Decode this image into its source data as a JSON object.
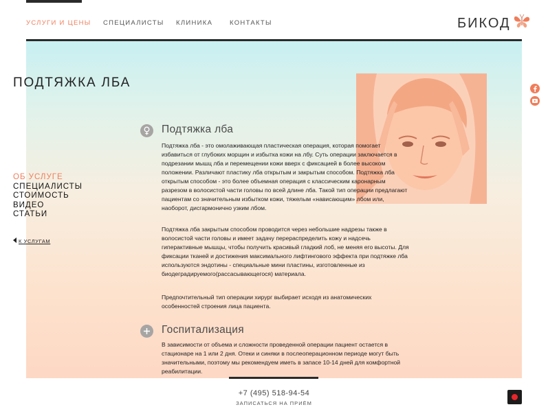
{
  "nav": {
    "items": [
      {
        "label": "УСЛУГИ И ЦЕНЫ"
      },
      {
        "label": "СПЕЦИАЛИСТЫ"
      },
      {
        "label": "КЛИНИКА"
      },
      {
        "label": "КОНТАКТЫ"
      }
    ],
    "active_index": 0,
    "logo_text": "БИКОД"
  },
  "page_title": "ПОДТЯЖКА ЛБА",
  "side_menu": {
    "items": [
      {
        "label": "ОБ УСЛУГЕ"
      },
      {
        "label": "СПЕЦИАЛИСТЫ"
      },
      {
        "label": "СТОИМОСТЬ"
      },
      {
        "label": "ВИДЕО"
      },
      {
        "label": "СТАТЬИ"
      }
    ],
    "active_index": 0,
    "back_label": "К УСЛУГАМ"
  },
  "sections": [
    {
      "icon": "female-symbol-icon",
      "title": "Подтяжка лба",
      "paragraphs": [
        "Подтяжка лба - это омолаживающая пластическая операция, которая помогает избавиться от глубоких морщин и избытка кожи на лбу. Суть операции заключается в подрезании мышц лба и перемещении кожи вверх с фиксацией в более высоком положении. Различают пластику лба открытым и закрытым  способом. Подтяжка лба открытым способом - это более объемная операция с классическим каронарным разрезом в волосистой части головы по всей длине лба. Такой тип операции предлагают пациентам со значительным избытком кожи, тяжелым «нависающим» лбом или, наоборот, дисгармонично узким лбом.",
        " Подтяжка лба закрытым способом проводится через небольшие надрезы также  в волосистой части головы и имеет задачу  перераспределить кожу  и надсечь гиперактивные мышцы, чтобы получить красивый гладкий лоб, не меняя его высоты.  Для фиксации тканей и достижения максимального лифтингового эффекта  при подтяжке лба используются эндотины - специальные мини пластины, изготовленные из биодеградируемого(рассасывающегося) материала.",
        "Предпочтительный тип операции хирург выбирает исходя из анатомических особенностей строения лица пациента."
      ]
    },
    {
      "icon": "plus-icon",
      "title": "Госпитализация",
      "paragraphs": [
        "В зависимости от объема и сложности проведенной операции пациент остается в стационаре на 1 или 2 дня. Отеки и синяки  в послеоперационном периоде могут быть значительными, поэтому мы рекомендуем иметь в запасе 10-14 дней для комфортной реабилитации."
      ]
    }
  ],
  "footer": {
    "phone": "+7 (495) 518-94-54",
    "signup_label": "ЗАПИСАТЬСЯ НА ПРИЁМ"
  },
  "social": [
    "facebook-icon",
    "youtube-icon"
  ],
  "colors": {
    "accent": "#f07d5a",
    "dark": "#2a2a2a",
    "icon_grey": "#a7a4a4"
  }
}
